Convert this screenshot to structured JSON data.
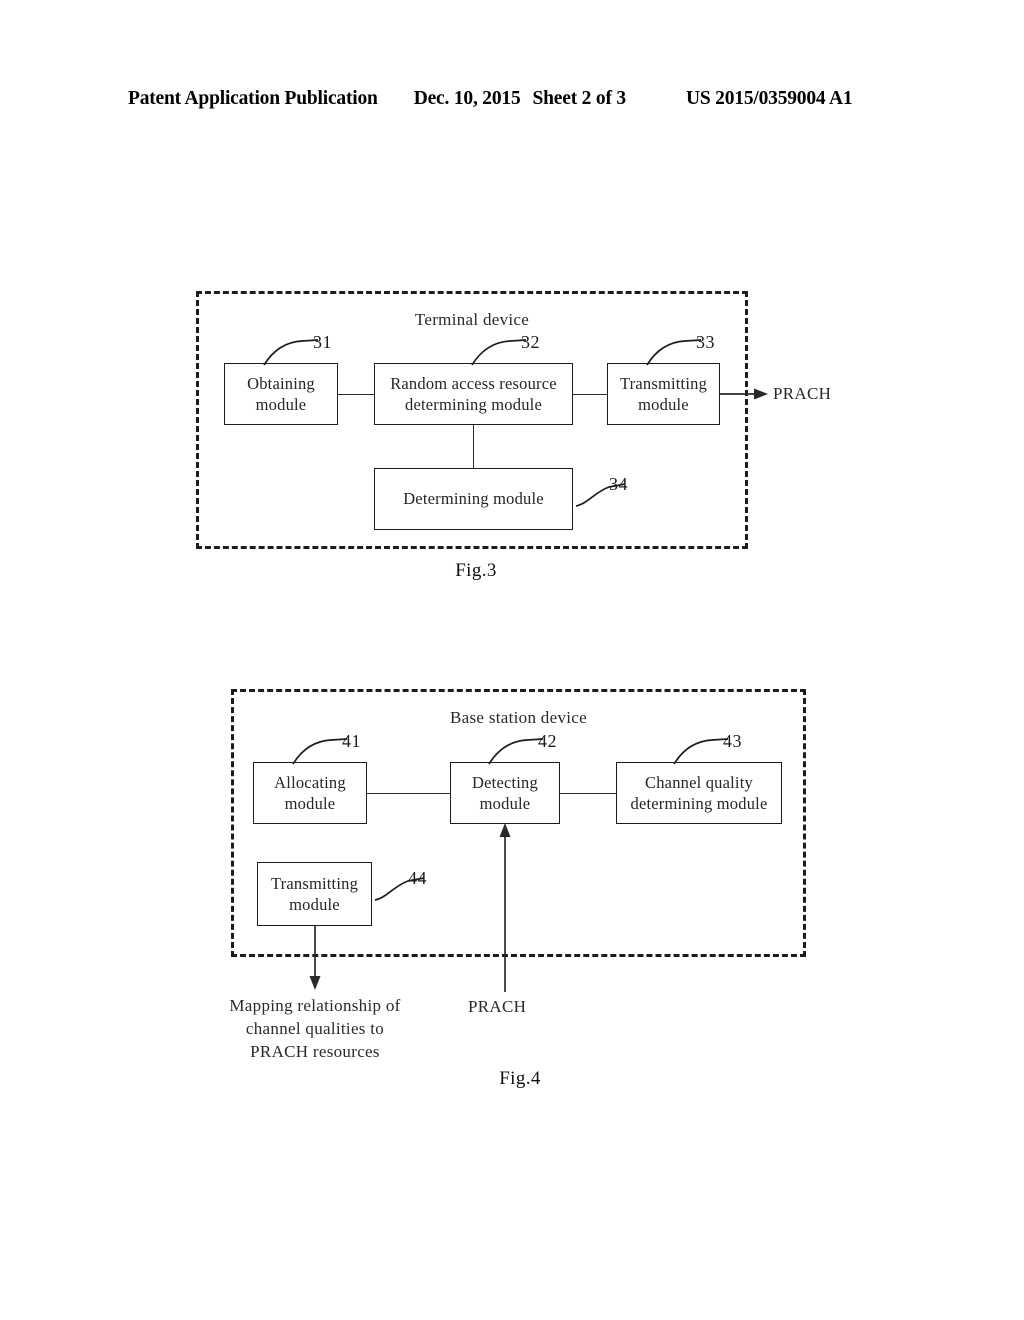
{
  "header": {
    "publication": "Patent Application Publication",
    "date": "Dec. 10, 2015",
    "sheet": "Sheet 2 of 3",
    "patent_number": "US 2015/0359004 A1"
  },
  "figures": [
    {
      "caption": "Fig.3",
      "device_title": "Terminal device",
      "modules": [
        {
          "ref": "31",
          "label": "Obtaining\nmodule"
        },
        {
          "ref": "32",
          "label": "Random access resource\ndetermining module"
        },
        {
          "ref": "33",
          "label": "Transmitting\nmodule"
        },
        {
          "ref": "34",
          "label": "Determining module"
        }
      ],
      "flow_labels": [
        {
          "name": "prach-output",
          "text": "PRACH"
        }
      ]
    },
    {
      "caption": "Fig.4",
      "device_title": "Base station device",
      "modules": [
        {
          "ref": "41",
          "label": "Allocating\nmodule"
        },
        {
          "ref": "42",
          "label": "Detecting\nmodule"
        },
        {
          "ref": "43",
          "label": "Channel quality\ndetermining module"
        },
        {
          "ref": "44",
          "label": "Transmitting\nmodule"
        }
      ],
      "flow_labels": [
        {
          "name": "mapping-output",
          "text": "Mapping relationship of channel qualities to PRACH resources"
        },
        {
          "name": "prach-input",
          "text": "PRACH"
        }
      ]
    }
  ]
}
